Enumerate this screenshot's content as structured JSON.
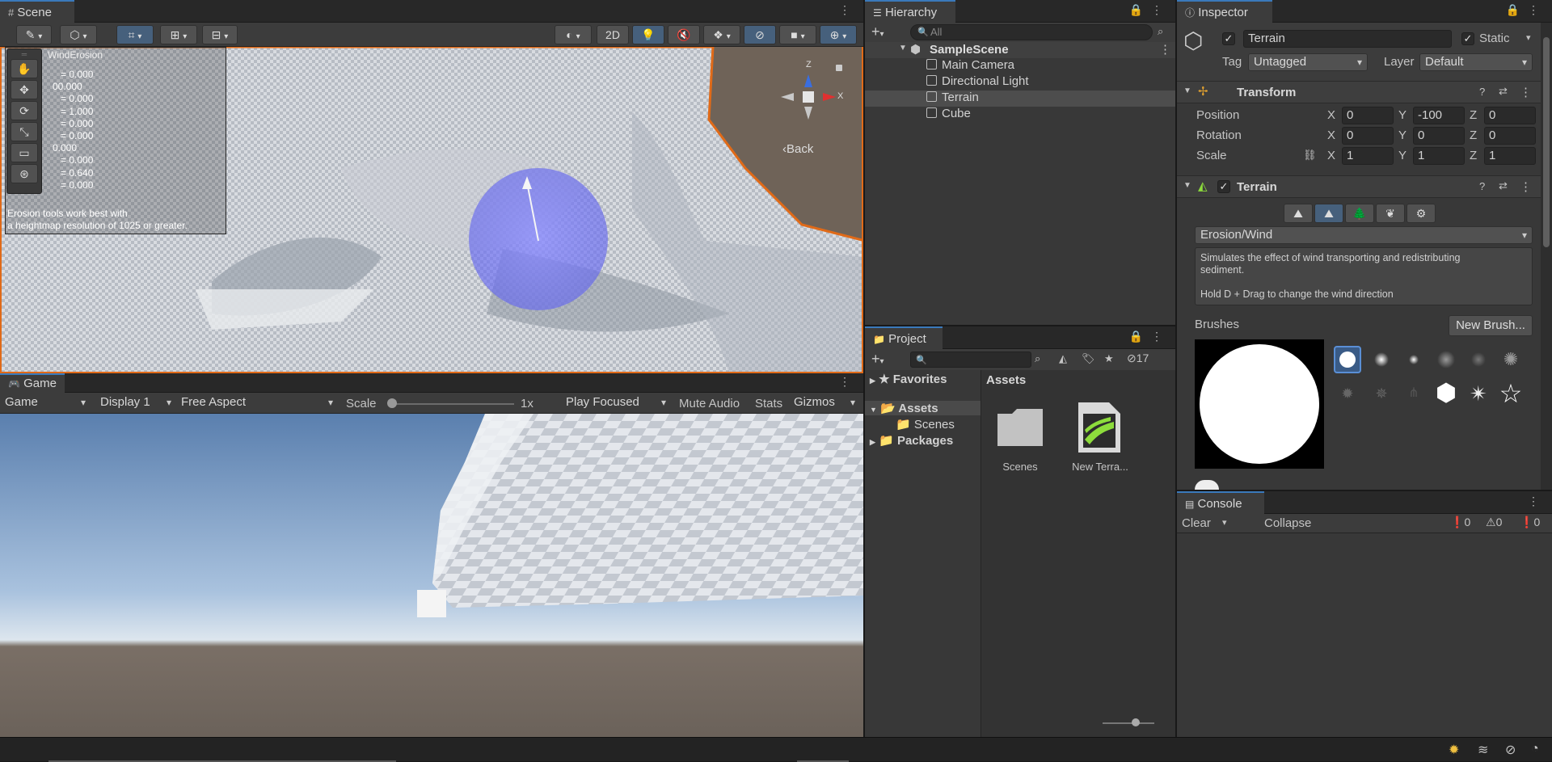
{
  "scene": {
    "tab_label": "Scene",
    "btn_2d": "2D",
    "back_label": "Back",
    "gizmo_z": "Z",
    "gizmo_x": "X",
    "overlay": {
      "title": "WindErosion",
      "values": [
        "= 0.000",
        "00.000",
        "= 0.000",
        "= 1.000",
        "= 0.000",
        "= 0.000",
        "0.000",
        "= 0.000",
        "= 0.640",
        "= 0.000"
      ],
      "note_line1": "Erosion tools work best with",
      "note_line2": "a heightmap resolution of 1025 or greater."
    }
  },
  "game": {
    "tab_label": "Game",
    "mode": "Game",
    "display": "Display 1",
    "aspect": "Free Aspect",
    "scale_label": "Scale",
    "scale_value": "1x",
    "scale_fraction": 0.02,
    "play_mode": "Play Focused",
    "mute": "Mute Audio",
    "stats": "Stats",
    "gizmos": "Gizmos"
  },
  "hierarchy": {
    "tab_label": "Hierarchy",
    "search_placeholder": "All",
    "scene_name": "SampleScene",
    "items": [
      "Main Camera",
      "Directional Light",
      "Terrain",
      "Cube"
    ],
    "selected_index": 2
  },
  "project": {
    "tab_label": "Project",
    "hidden_count": "17",
    "tree": {
      "favorites": "Favorites",
      "assets": "Assets",
      "scenes": "Scenes",
      "packages": "Packages"
    },
    "breadcrumb": "Assets",
    "assets": [
      {
        "name": "Scenes",
        "icon": "folder-icon"
      },
      {
        "name": "New Terra...",
        "icon": "terrain-asset-icon"
      }
    ]
  },
  "inspector": {
    "tab_label": "Inspector",
    "object_name": "Terrain",
    "static_label": "Static",
    "tag_label": "Tag",
    "tag_value": "Untagged",
    "layer_label": "Layer",
    "layer_value": "Default",
    "transform": {
      "title": "Transform",
      "rows": [
        {
          "label": "Position",
          "x": "0",
          "y": "-100",
          "z": "0"
        },
        {
          "label": "Rotation",
          "x": "0",
          "y": "0",
          "z": "0"
        },
        {
          "label": "Scale",
          "x": "1",
          "y": "1",
          "z": "1"
        }
      ],
      "axis_x": "X",
      "axis_y": "Y",
      "axis_z": "Z"
    },
    "terrain": {
      "title": "Terrain",
      "tool": "Erosion/Wind",
      "description_line1": "Simulates the effect of wind transporting and redistributing",
      "description_line2": "sediment.",
      "description_line3": "Hold D + Drag to change the wind direction",
      "brushes_label": "Brushes",
      "new_brush": "New Brush..."
    }
  },
  "console": {
    "tab_label": "Console",
    "clear": "Clear",
    "collapse": "Collapse",
    "info_count": "0",
    "warn_count": "0",
    "error_count": "0"
  }
}
